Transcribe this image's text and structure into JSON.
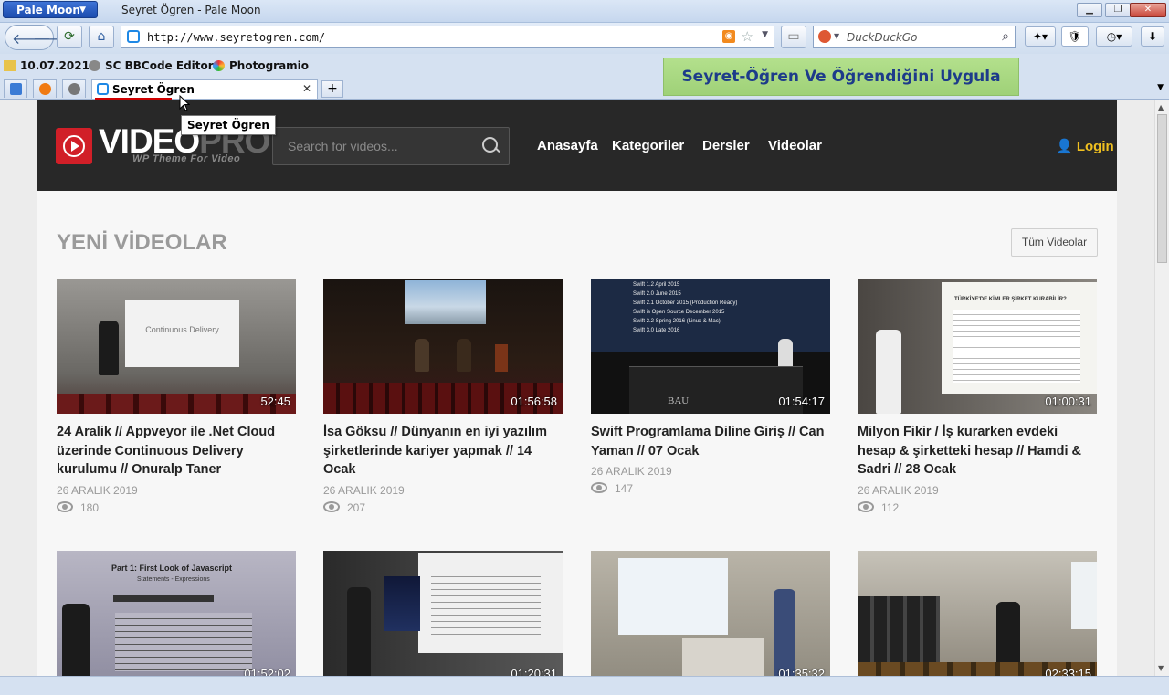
{
  "browser": {
    "app_button": "Pale Moon",
    "window_title": "Seyret Ögren - Pale Moon",
    "url": "http://www.seyretogren.com/",
    "search_engine": "DuckDuckGo",
    "bookmarks": [
      "10.07.2021",
      "SC BBCode Editor",
      "Photogramio"
    ],
    "active_tab": "Seyret Ögren",
    "tooltip": "Seyret Ögren",
    "tagline": "Seyret-Öğren Ve Öğrendiğini Uygula"
  },
  "site": {
    "logo_main": "VIDEO",
    "logo_accent": "PRO",
    "logo_sub": "WP Theme For Video",
    "search_placeholder": "Search for videos...",
    "nav": [
      "Anasayfa",
      "Kategoriler",
      "Dersler",
      "Videolar"
    ],
    "login": "Login",
    "section_title": "YENİ VİDEOLAR",
    "all_videos": "Tüm Videolar"
  },
  "videos": [
    {
      "title": "24 Aralik // Appveyor ile .Net Cloud üzerinde Continuous Delivery kurulumu // Onuralp Taner",
      "date": "26 ARALIK 2019",
      "views": "180",
      "duration": "52:45",
      "slide": "Continuous Delivery"
    },
    {
      "title": "İsa Göksu // Dünyanın en iyi yazılım şirketlerinde kariyer yapmak // 14 Ocak",
      "date": "26 ARALIK 2019",
      "views": "207",
      "duration": "01:56:58"
    },
    {
      "title": "Swift Programlama Diline Giriş // Can Yaman // 07 Ocak",
      "date": "26 ARALIK 2019",
      "views": "147",
      "duration": "01:54:17",
      "slide_lines": [
        "Swift 1.2   April 2015",
        "Swift 2.0   June 2015",
        "Swift 2.1   October 2015 (Production Ready)",
        "Swift is Open Source   December 2015",
        "Swift 2.2   Spring 2016 (Linux & Mac)",
        "Swift 3.0   Late 2016"
      ],
      "podium": "BAU"
    },
    {
      "title": "Milyon Fikir / İş kurarken evdeki hesap & şirketteki hesap // Hamdi & Sadri // 28 Ocak",
      "date": "26 ARALIK 2019",
      "views": "112",
      "duration": "01:00:31",
      "slide": "TÜRKİYE'DE KİMLER ŞİRKET KURABİLİR?"
    },
    {
      "duration": "01:52:02",
      "slide": "Part 1: First Look of Javascript",
      "slide_sub": "Statements - Expressions"
    },
    {
      "duration": "01:20:31"
    },
    {
      "duration": "01:35:32"
    },
    {
      "duration": "02:33:15"
    }
  ]
}
